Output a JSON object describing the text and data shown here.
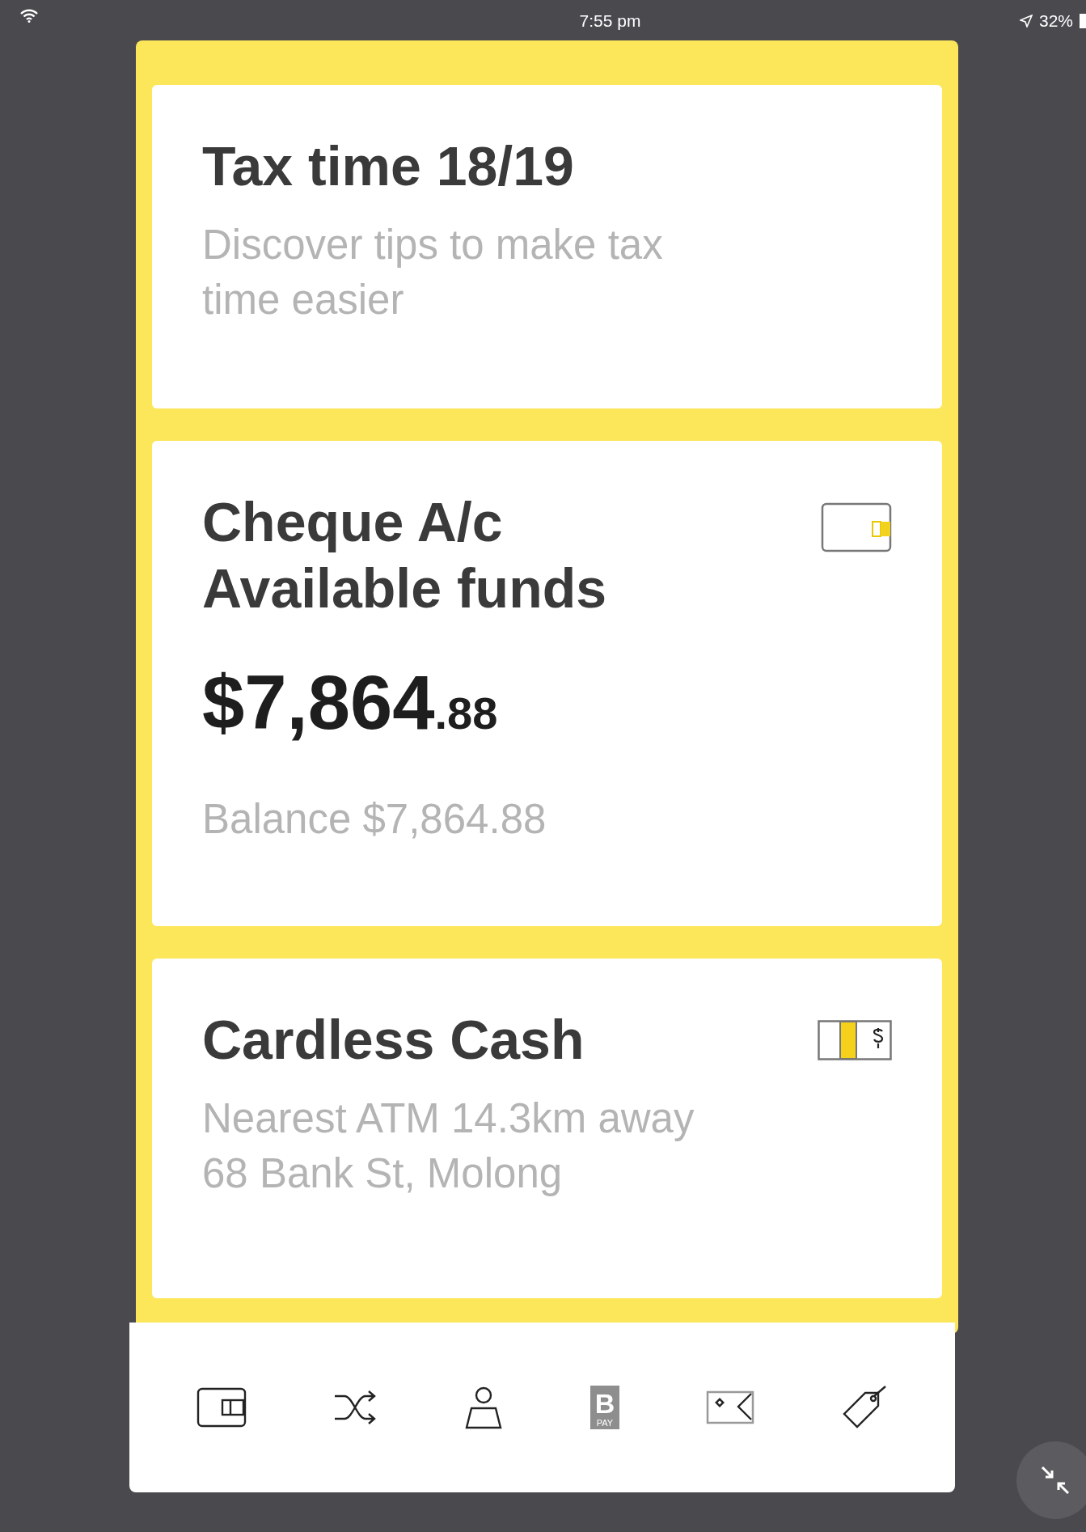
{
  "status_bar": {
    "time": "7:55 pm",
    "battery": "32%"
  },
  "cards": [
    {
      "kind": "promo",
      "title": "Tax time 18/19",
      "lines": [
        "Discover tips to make tax",
        "time easier"
      ]
    },
    {
      "kind": "account",
      "title": "Cheque A/c",
      "subtitle": "Available funds",
      "amount": "$7,864",
      "cents": ".88",
      "lines": [
        "Balance $7,864.88"
      ]
    },
    {
      "kind": "cardless",
      "title": "Cardless Cash",
      "lines": [
        "Nearest ATM 14.3km away",
        "68 Bank St, Molong"
      ]
    }
  ],
  "nav": [
    {
      "kind": "wallet"
    },
    {
      "kind": "transfer"
    },
    {
      "kind": "person"
    },
    {
      "kind": "bpay",
      "mark": "B",
      "caption": "PAY"
    },
    {
      "kind": "envelope"
    },
    {
      "kind": "tag"
    }
  ]
}
